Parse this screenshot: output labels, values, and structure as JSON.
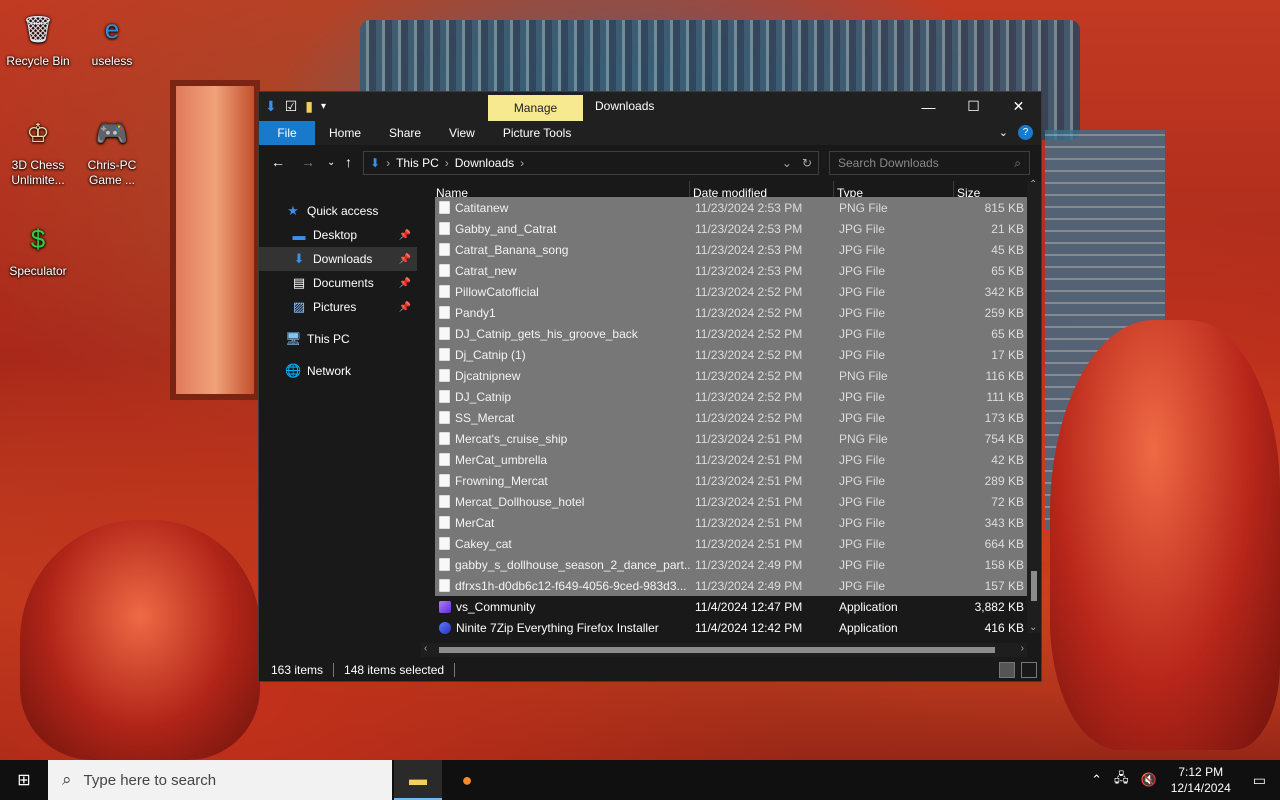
{
  "desktop": {
    "icons": [
      {
        "label": "Recycle Bin",
        "icon": "recycle-bin-icon",
        "glyph": "🗑"
      },
      {
        "label": "useless",
        "icon": "edge-icon",
        "glyph": "e"
      },
      {
        "label": "3D Chess Unlimite...",
        "icon": "chess-icon",
        "glyph": "♔"
      },
      {
        "label": "Chris-PC Game ...",
        "icon": "game-icon",
        "glyph": "🎮"
      },
      {
        "label": "Speculator",
        "icon": "speculator-icon",
        "glyph": "$"
      }
    ]
  },
  "window": {
    "title": "Downloads",
    "manage_tab": "Manage",
    "ribbon_tabs": [
      "File",
      "Home",
      "Share",
      "View",
      "Picture Tools"
    ],
    "breadcrumb": [
      "This PC",
      "Downloads"
    ],
    "search_placeholder": "Search Downloads"
  },
  "nav": {
    "quick_access": "Quick access",
    "items": [
      "Desktop",
      "Downloads",
      "Documents",
      "Pictures"
    ],
    "this_pc": "This PC",
    "network": "Network"
  },
  "columns": {
    "name": "Name",
    "date": "Date modified",
    "type": "Type",
    "size": "Size"
  },
  "files": [
    {
      "name": "Catitanew",
      "date": "11/23/2024 2:53 PM",
      "type": "PNG File",
      "size": "815 KB",
      "selected": true,
      "kind": "image"
    },
    {
      "name": "Gabby_and_Catrat",
      "date": "11/23/2024 2:53 PM",
      "type": "JPG File",
      "size": "21 KB",
      "selected": true,
      "kind": "image"
    },
    {
      "name": "Catrat_Banana_song",
      "date": "11/23/2024 2:53 PM",
      "type": "JPG File",
      "size": "45 KB",
      "selected": true,
      "kind": "image"
    },
    {
      "name": "Catrat_new",
      "date": "11/23/2024 2:53 PM",
      "type": "JPG File",
      "size": "65 KB",
      "selected": true,
      "kind": "image"
    },
    {
      "name": "PillowCatofficial",
      "date": "11/23/2024 2:52 PM",
      "type": "JPG File",
      "size": "342 KB",
      "selected": true,
      "kind": "image"
    },
    {
      "name": "Pandy1",
      "date": "11/23/2024 2:52 PM",
      "type": "JPG File",
      "size": "259 KB",
      "selected": true,
      "kind": "image"
    },
    {
      "name": "DJ_Catnip_gets_his_groove_back",
      "date": "11/23/2024 2:52 PM",
      "type": "JPG File",
      "size": "65 KB",
      "selected": true,
      "kind": "image"
    },
    {
      "name": "Dj_Catnip (1)",
      "date": "11/23/2024 2:52 PM",
      "type": "JPG File",
      "size": "17 KB",
      "selected": true,
      "kind": "image"
    },
    {
      "name": "Djcatnipnew",
      "date": "11/23/2024 2:52 PM",
      "type": "PNG File",
      "size": "116 KB",
      "selected": true,
      "kind": "image"
    },
    {
      "name": "DJ_Catnip",
      "date": "11/23/2024 2:52 PM",
      "type": "JPG File",
      "size": "111 KB",
      "selected": true,
      "kind": "image"
    },
    {
      "name": "SS_Mercat",
      "date": "11/23/2024 2:52 PM",
      "type": "JPG File",
      "size": "173 KB",
      "selected": true,
      "kind": "image"
    },
    {
      "name": "Mercat's_cruise_ship",
      "date": "11/23/2024 2:51 PM",
      "type": "PNG File",
      "size": "754 KB",
      "selected": true,
      "kind": "image"
    },
    {
      "name": "MerCat_umbrella",
      "date": "11/23/2024 2:51 PM",
      "type": "JPG File",
      "size": "42 KB",
      "selected": true,
      "kind": "image"
    },
    {
      "name": "Frowning_Mercat",
      "date": "11/23/2024 2:51 PM",
      "type": "JPG File",
      "size": "289 KB",
      "selected": true,
      "kind": "image"
    },
    {
      "name": "Mercat_Dollhouse_hotel",
      "date": "11/23/2024 2:51 PM",
      "type": "JPG File",
      "size": "72 KB",
      "selected": true,
      "kind": "image"
    },
    {
      "name": "MerCat",
      "date": "11/23/2024 2:51 PM",
      "type": "JPG File",
      "size": "343 KB",
      "selected": true,
      "kind": "image"
    },
    {
      "name": "Cakey_cat",
      "date": "11/23/2024 2:51 PM",
      "type": "JPG File",
      "size": "664 KB",
      "selected": true,
      "kind": "image"
    },
    {
      "name": "gabby_s_dollhouse_season_2_dance_part...",
      "date": "11/23/2024 2:49 PM",
      "type": "JPG File",
      "size": "158 KB",
      "selected": true,
      "kind": "image"
    },
    {
      "name": "dfrxs1h-d0db6c12-f649-4056-9ced-983d3...",
      "date": "11/23/2024 2:49 PM",
      "type": "JPG File",
      "size": "157 KB",
      "selected": true,
      "kind": "image"
    },
    {
      "name": "vs_Community",
      "date": "11/4/2024 12:47 PM",
      "type": "Application",
      "size": "3,882 KB",
      "selected": false,
      "kind": "app-vs"
    },
    {
      "name": "Ninite 7Zip Everything Firefox Installer",
      "date": "11/4/2024 12:42 PM",
      "type": "Application",
      "size": "416 KB",
      "selected": false,
      "kind": "app-ninite"
    }
  ],
  "status": {
    "count": "163 items",
    "selected": "148 items selected"
  },
  "taskbar": {
    "search_placeholder": "Type here to search",
    "time": "7:12 PM",
    "date": "12/14/2024"
  }
}
